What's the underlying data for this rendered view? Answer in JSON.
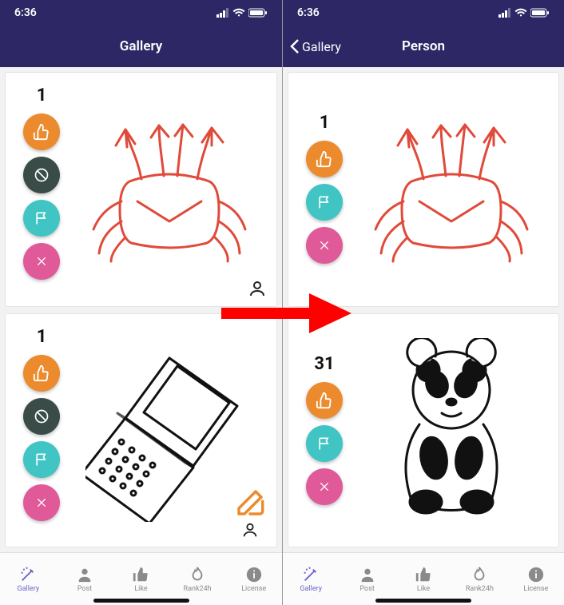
{
  "status": {
    "time": "6:36"
  },
  "left": {
    "title": "Gallery",
    "cards": [
      {
        "count": "1",
        "buttons": [
          "like",
          "ban",
          "flag",
          "close"
        ],
        "drawing": "crab",
        "corner": "person"
      },
      {
        "count": "1",
        "buttons": [
          "like",
          "ban",
          "flag",
          "close"
        ],
        "drawing": "phone",
        "corner": "edit-person"
      }
    ]
  },
  "right": {
    "title": "Person",
    "back": "Gallery",
    "cards": [
      {
        "count": "1",
        "buttons": [
          "like",
          "flag",
          "close"
        ],
        "drawing": "crab"
      },
      {
        "count": "31",
        "buttons": [
          "like",
          "flag",
          "close"
        ],
        "drawing": "panda"
      }
    ]
  },
  "tabs": [
    {
      "label": "Gallery",
      "icon": "wand",
      "active": true
    },
    {
      "label": "Post",
      "icon": "person",
      "active": false
    },
    {
      "label": "Like",
      "icon": "thumb",
      "active": false
    },
    {
      "label": "Rank24h",
      "icon": "flame",
      "active": false
    },
    {
      "label": "License",
      "icon": "info",
      "active": false
    }
  ]
}
